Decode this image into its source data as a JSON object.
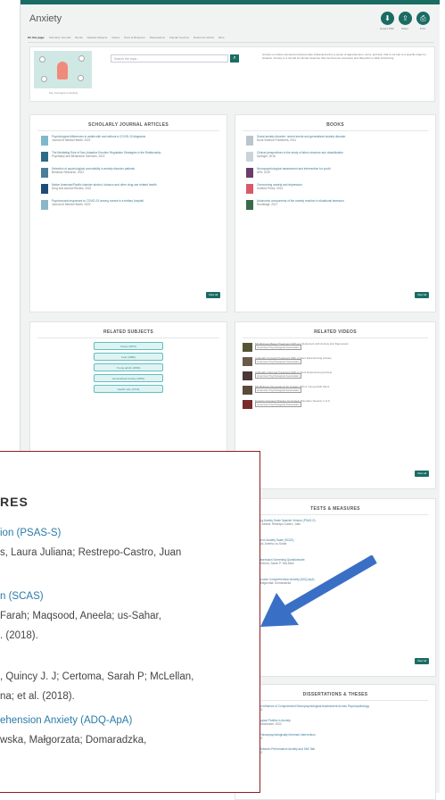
{
  "app": {
    "title": "Anxiety",
    "colors": {
      "primary": "#1a6c63",
      "accent_link": "#2a7ba8",
      "highlight_border": "#8b1f1f",
      "arrow": "#3a6fc6"
    }
  },
  "header_actions": [
    {
      "icon": "download-icon",
      "label": "Export PDF"
    },
    {
      "icon": "share-icon",
      "label": "Share"
    },
    {
      "icon": "print-icon",
      "label": "Print"
    }
  ],
  "topnav": [
    "On this page:",
    "Scholarly Journals",
    "Books",
    "Related Subjects",
    "Videos",
    "Tests & Measures",
    "Dissertations",
    "Popular Sources",
    "Reference Works",
    "More"
  ],
  "hero": {
    "search_placeholder": "Search the topic...",
    "caption": "Key Concepts in Anxiety",
    "description": "Anxiety is a future-oriented emotional state characterized by a sense of apprehension, worry, and fear, that is not tied to a specific object or situation. Anxiety is a normal emotional response that can become excessive and disruptive to daily functioning."
  },
  "journals": {
    "title": "SCHOLARLY JOURNAL ARTICLES",
    "items": [
      {
        "title": "Psychological differences in adults with and without a COVID-19 diagnosis",
        "meta": "Journal of Mental Health, 2022"
      },
      {
        "title": "The Mediating Role of Non-Adaptive Emotion Regulation Strategies in the Relationship",
        "meta": "Psychiatry and Behavioral Sciences, 2022"
      },
      {
        "title": "Detection of psychological comorbidity in anxiety disorder patients",
        "meta": "Behavior Research, 2022"
      },
      {
        "title": "Native American/Pacific Islander alcohol, tobacco and other drug use related health",
        "meta": "Drug and Alcohol Review, 2022"
      },
      {
        "title": "Psychosocial responses to COVID-19 among nurses in a tertiary hospital",
        "meta": "Journal of Mental Health, 2022"
      }
    ],
    "view_all": "View all"
  },
  "books": {
    "title": "BOOKS",
    "items": [
      {
        "title": "Social anxiety disorder: recent trends and generalized anxiety disorder",
        "meta": "Nova Science Publishers, 2011"
      },
      {
        "title": "Clinical perspectives in the study of fabric structure and classification",
        "meta": "Springer, 2016"
      },
      {
        "title": "Neuropsychological assessment and intervention for youth",
        "meta": "APA, 2019"
      },
      {
        "title": "Overcoming anxiety and depression",
        "meta": "Guilford Press, 2013"
      },
      {
        "title": "Autonomic components of the anxiety reaction in situational stressors",
        "meta": "Routledge, 2017"
      }
    ],
    "view_all": "View all"
  },
  "subjects": {
    "title": "RELATED SUBJECTS",
    "items": [
      "Stress (5872)",
      "Fear (3698)",
      "Young adults (2966)",
      "Generalized Anxiety (2851)",
      "Health care (2719)"
    ]
  },
  "videos": {
    "title": "RELATED VIDEOS",
    "items": [
      {
        "title": "Mindfulness-Based Treatment With an Adolescent with Anxiety and Depression",
        "meta": "American Psychological Association"
      },
      {
        "title": "Culturally Focused Treatment With a Client Experiencing Anxiety",
        "meta": "American Psychological Association"
      },
      {
        "title": "Culturally Informed Treatment With a Client Experiencing Anxiety",
        "meta": "American Psychological Association"
      },
      {
        "title": "Mindfulness Interventions for Anxiety With a Young Adult Client",
        "meta": "American Psychological Association"
      },
      {
        "title": "Emotion-Focused Therapy for Anxiety Disorders Session 1 of 6",
        "meta": "American Psychological Association"
      }
    ],
    "view_all": "View all"
  },
  "tests": {
    "title": "TESTS & MEASURES",
    "items": [
      {
        "title": "Public Speaking Anxiety Scale Spanish Version (PSAS-S)",
        "authors": "Cuervo, Laura Juliana; Restrepo-Castro, Juan"
      },
      {
        "title": "Spence Children's Anxiety Scale (SCAS)",
        "authors": "Farah; Maqsood, Aneela; us-Sahar"
      },
      {
        "title": "Anxiety and Depression Screening Questionnaire",
        "authors": "Quincy J. J; Certoma, Sarah P; McLellan"
      },
      {
        "title": "Academic Discourse Comprehension Anxiety (ADQ-ApA)",
        "authors": "Wasilewska, Małgorzata; Domaradzka"
      }
    ],
    "view_all": "View all"
  },
  "dissertations": {
    "title": "DISSERTATIONS & THESES",
    "items": [
      {
        "title": "The Differential Influence of Computerized Neuropsychological Assessment Across Psychopathology",
        "meta": "ProQuest, 2023"
      },
      {
        "title": "Neuropsychological Profiles in Anxiety",
        "meta": "University of Manchester, 2022"
      },
      {
        "title": "The Effects of Neuropsychologically Informed Intervention",
        "meta": "ProQuest, 2022"
      },
      {
        "title": "The Relation Between Performance Anxiety and Self-Talk",
        "meta": "ProQuest, 2022"
      }
    ]
  },
  "zoom": {
    "section_title": "RES",
    "lines": [
      {
        "text": "ion (PSAS-S)",
        "kind": "link"
      },
      {
        "text": "s, Laura Juliana; Restrepo-Castro, Juan",
        "kind": "author"
      },
      {
        "text": "n (SCAS)",
        "kind": "link"
      },
      {
        "text": "Farah; Maqsood, Aneela; us-Sahar,",
        "kind": "author"
      },
      {
        "text": ". (2018).",
        "kind": "author"
      },
      {
        "text": ", Quincy J. J; Certoma, Sarah P; McLellan,",
        "kind": "author"
      },
      {
        "text": "na; et al. (2018).",
        "kind": "author"
      },
      {
        "text": "ehension Anxiety (ADQ-ApA)",
        "kind": "link"
      },
      {
        "text": "wska, Małgorzata; Domaradzka,",
        "kind": "author"
      }
    ]
  }
}
